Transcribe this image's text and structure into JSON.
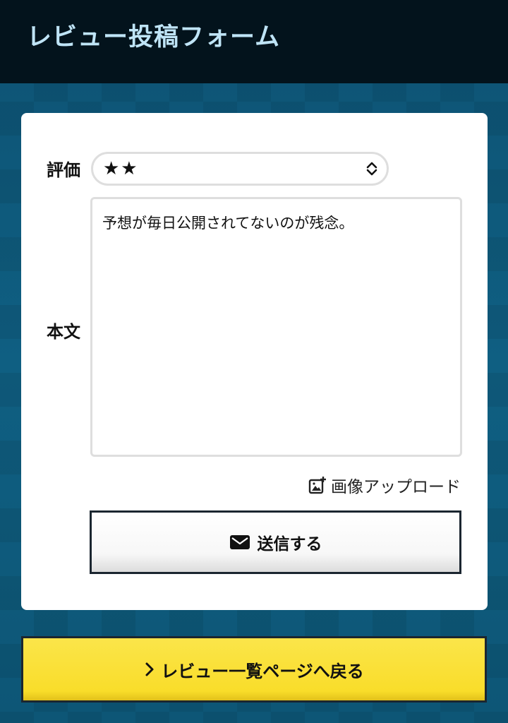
{
  "header": {
    "title": "レビュー投稿フォーム"
  },
  "form": {
    "rating_label": "評価",
    "rating_value": "★★",
    "body_label": "本文",
    "body_value": "予想が毎日公開されてないのが残念。",
    "upload_label": "画像アップロード",
    "submit_label": "送信する"
  },
  "footer": {
    "back_label": "レビュー一覧ページへ戻る"
  },
  "colors": {
    "header_bg": "#03131c",
    "header_text": "#bfe4f6",
    "page_bg": "#0e5878",
    "back_button_bg": "#f9dd2a"
  }
}
